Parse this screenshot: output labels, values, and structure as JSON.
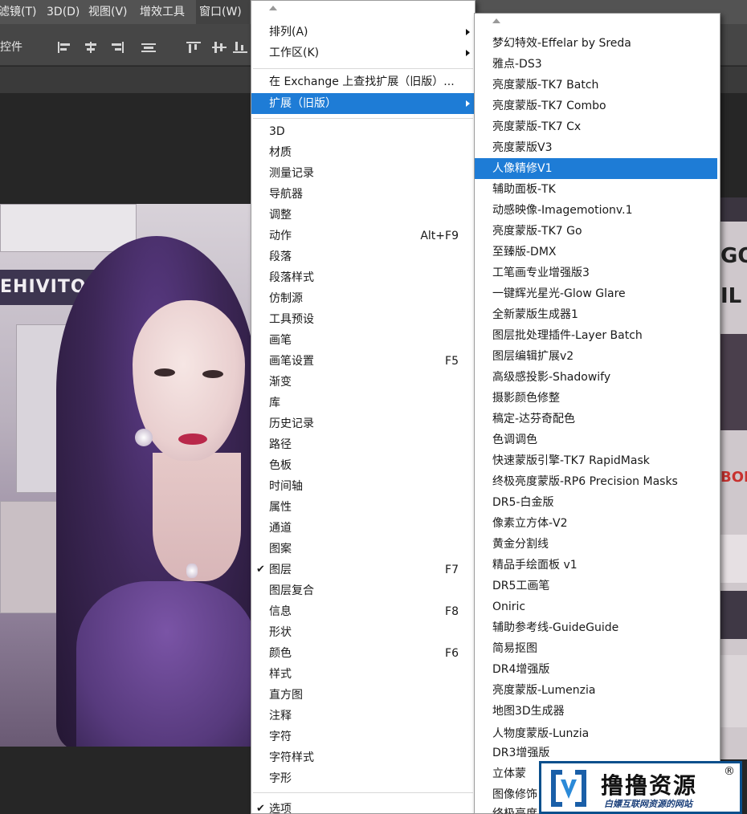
{
  "menubar": {
    "items": [
      {
        "label": "滤镜(T)"
      },
      {
        "label": "3D(D)"
      },
      {
        "label": "视图(V)"
      },
      {
        "label": "增效工具"
      },
      {
        "label": "窗口(W)"
      }
    ]
  },
  "optionsbar": {
    "label": "控件",
    "icons": [
      "align-left-icon",
      "align-hcenter-icon",
      "align-right-icon",
      "align-justify-icon",
      "align-top-icon",
      "align-vcenter-icon",
      "align-bottom-icon"
    ]
  },
  "photo": {
    "banner_text": "EHIVITO"
  },
  "rightstrip": {
    "text1": "GO",
    "text2": "IL",
    "text3": "BOP"
  },
  "window_menu": {
    "top_items": [
      {
        "label": "排列(A)",
        "submenu": true
      },
      {
        "label": "工作区(K)",
        "submenu": true
      }
    ],
    "mid_items": [
      {
        "label": "在 Exchange 上查找扩展（旧版）..."
      },
      {
        "label": "扩展（旧版）",
        "submenu": true,
        "highlighted": true
      }
    ],
    "panel_items": [
      {
        "label": "3D"
      },
      {
        "label": "材质"
      },
      {
        "label": "测量记录"
      },
      {
        "label": "导航器"
      },
      {
        "label": "调整"
      },
      {
        "label": "动作",
        "shortcut": "Alt+F9"
      },
      {
        "label": "段落"
      },
      {
        "label": "段落样式"
      },
      {
        "label": "仿制源"
      },
      {
        "label": "工具预设"
      },
      {
        "label": "画笔"
      },
      {
        "label": "画笔设置",
        "shortcut": "F5"
      },
      {
        "label": "渐变"
      },
      {
        "label": "库"
      },
      {
        "label": "历史记录"
      },
      {
        "label": "路径"
      },
      {
        "label": "色板"
      },
      {
        "label": "时间轴"
      },
      {
        "label": "属性"
      },
      {
        "label": "通道"
      },
      {
        "label": "图案"
      },
      {
        "label": "图层",
        "shortcut": "F7",
        "checked": true
      },
      {
        "label": "图层复合"
      },
      {
        "label": "信息",
        "shortcut": "F8"
      },
      {
        "label": "形状"
      },
      {
        "label": "颜色",
        "shortcut": "F6"
      },
      {
        "label": "样式"
      },
      {
        "label": "直方图"
      },
      {
        "label": "注释"
      },
      {
        "label": "字符"
      },
      {
        "label": "字符样式"
      },
      {
        "label": "字形"
      }
    ],
    "bottom_items": [
      {
        "label": "选项",
        "checked": true
      }
    ]
  },
  "extensions_menu": {
    "items": [
      {
        "label": "梦幻特效-Effelar by Sreda"
      },
      {
        "label": "雅点-DS3"
      },
      {
        "label": "亮度蒙版-TK7 Batch"
      },
      {
        "label": "亮度蒙版-TK7 Combo"
      },
      {
        "label": "亮度蒙版-TK7 Cx"
      },
      {
        "label": "亮度蒙版V3"
      },
      {
        "label": "人像精修V1",
        "highlighted": true
      },
      {
        "label": "辅助面板-TK"
      },
      {
        "label": "动感映像-Imagemotionv.1"
      },
      {
        "label": "亮度蒙版-TK7 Go"
      },
      {
        "label": "至臻版-DMX"
      },
      {
        "label": "工笔画专业增强版3"
      },
      {
        "label": "一键辉光星光-Glow Glare"
      },
      {
        "label": "全新蒙版生成器1"
      },
      {
        "label": "图层批处理插件-Layer Batch"
      },
      {
        "label": "图层编辑扩展v2"
      },
      {
        "label": "高级感投影-Shadowify"
      },
      {
        "label": "摄影颜色修整"
      },
      {
        "label": "稿定-达芬奇配色"
      },
      {
        "label": "色调调色"
      },
      {
        "label": "快速蒙版引擎-TK7 RapidMask"
      },
      {
        "label": "终极亮度蒙版-RP6 Precision Masks"
      },
      {
        "label": "DR5-白金版"
      },
      {
        "label": "像素立方体-V2"
      },
      {
        "label": "黄金分割线"
      },
      {
        "label": "精品手绘面板 v1"
      },
      {
        "label": "DR5工画笔"
      },
      {
        "label": "Oniric"
      },
      {
        "label": "辅助参考线-GuideGuide"
      },
      {
        "label": "简易抠图"
      },
      {
        "label": "DR4增强版"
      },
      {
        "label": "亮度蒙版-Lumenzia"
      },
      {
        "label": "地图3D生成器"
      },
      {
        "label": "人物度蒙版-Lunzia"
      },
      {
        "label": "DR3增强版"
      },
      {
        "label": "立体蒙"
      },
      {
        "label": "图像修饰"
      },
      {
        "label": "终极亮度"
      }
    ]
  },
  "watermark": {
    "title": "撸撸资源",
    "registered": "®",
    "subtitle": "白嫖互联网资源的网站"
  },
  "colors": {
    "highlight": "#1e7cd6",
    "menubar": "#535353",
    "watermark_border": "#0a4f8c"
  }
}
